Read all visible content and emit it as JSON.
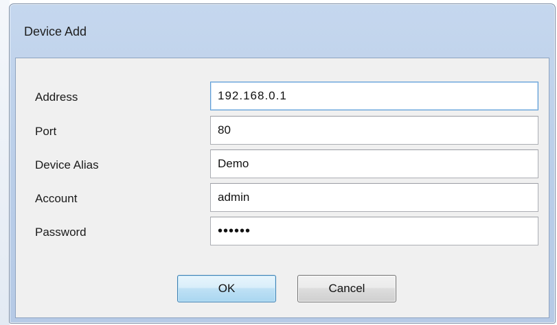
{
  "window": {
    "title": "Device Add"
  },
  "form": {
    "address": {
      "label": "Address",
      "value": "192.168.0.1"
    },
    "port": {
      "label": "Port",
      "value": "80"
    },
    "alias": {
      "label": "Device Alias",
      "value": "Demo"
    },
    "account": {
      "label": "Account",
      "value": "admin"
    },
    "password": {
      "label": "Password",
      "value": "••••••"
    }
  },
  "buttons": {
    "ok": "OK",
    "cancel": "Cancel"
  },
  "colors": {
    "titlebar": "#c5d7ee",
    "client_bg": "#f0f0f0",
    "focus_border": "#5b9bd5",
    "ok_button": "#bfe1f5"
  }
}
